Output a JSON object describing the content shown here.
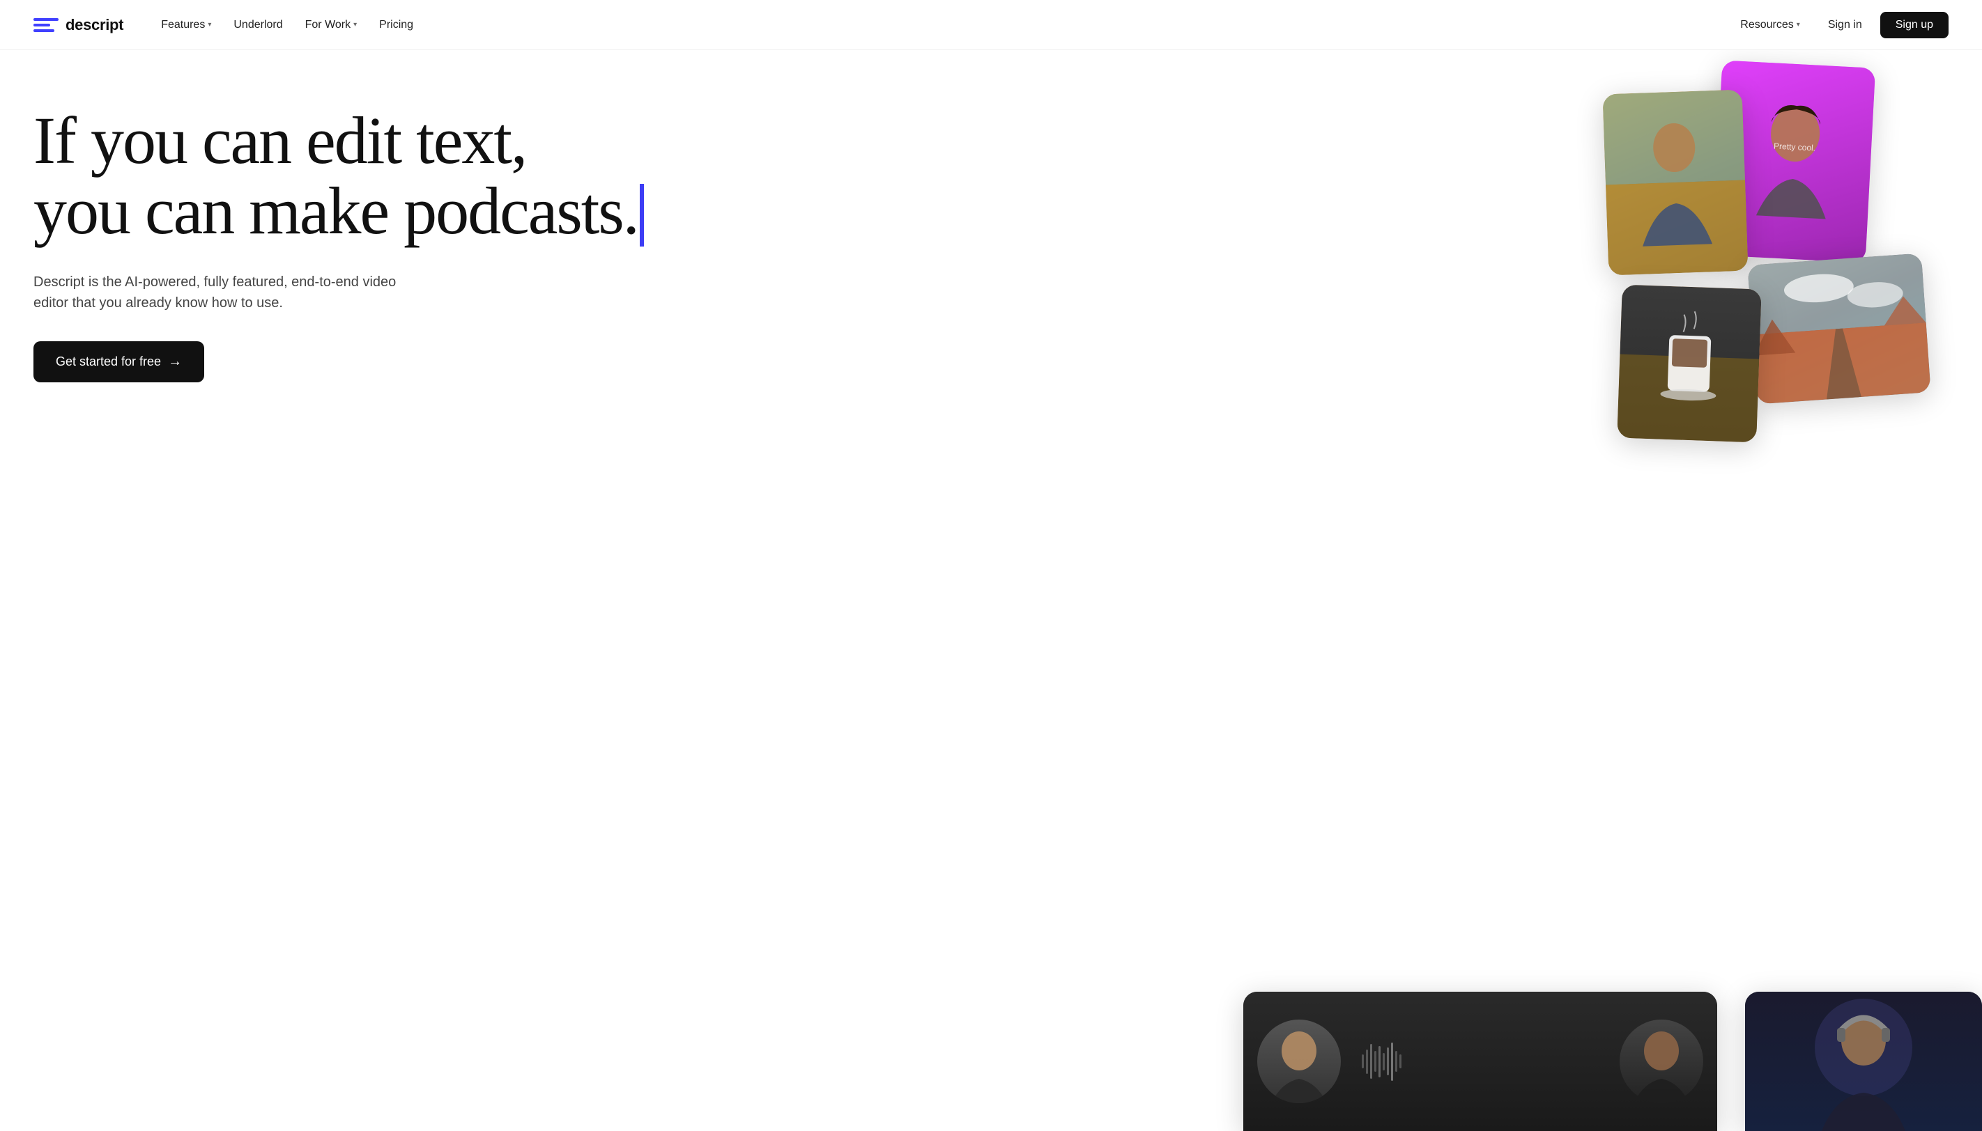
{
  "logo": {
    "text": "descript",
    "icon_label": "descript-logo-icon"
  },
  "nav": {
    "left": [
      {
        "label": "Features",
        "has_dropdown": true
      },
      {
        "label": "Underlord",
        "has_dropdown": false
      },
      {
        "label": "For Work",
        "has_dropdown": true
      },
      {
        "label": "Pricing",
        "has_dropdown": false
      }
    ],
    "right": [
      {
        "label": "Resources",
        "has_dropdown": true
      },
      {
        "label": "Sign in",
        "has_dropdown": false
      },
      {
        "label": "Sign up",
        "is_primary": true
      }
    ]
  },
  "hero": {
    "heading_line1": "If you can edit text,",
    "heading_line2": "you can make podcasts.",
    "subheading": "Descript is the AI-powered, fully featured, end-to-end video editor\nthat you already know how to use.",
    "cta_label": "Get started for free",
    "cta_arrow": "→"
  },
  "images": {
    "card1_alt": "Person with pink background",
    "card2_alt": "Person outdoors",
    "card3_alt": "Landscape desert road",
    "card4_alt": "Food scene",
    "card5_alt": "Video podcast frame",
    "card6_alt": "Person with headphones"
  }
}
